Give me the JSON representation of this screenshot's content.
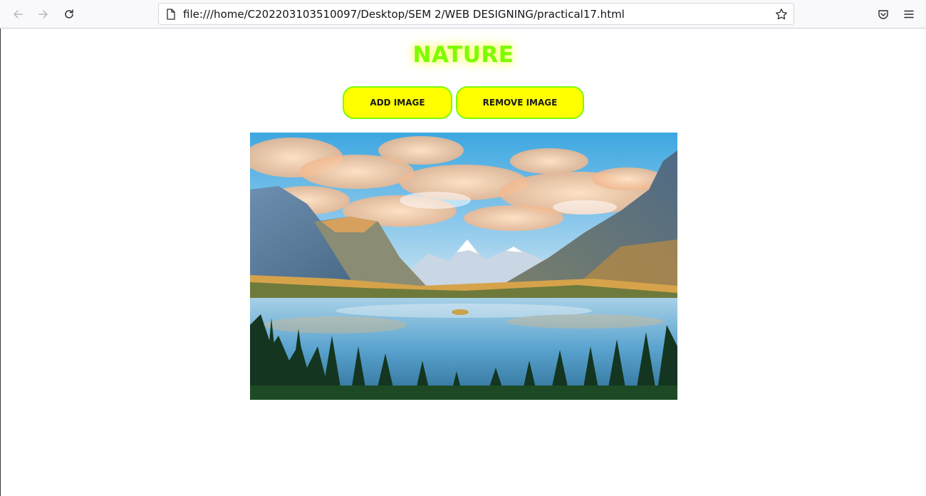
{
  "browser": {
    "url": "file:///home/C202203103510097/Desktop/SEM 2/WEB DESIGNING/practical17.html",
    "icons": [
      "back-arrow-icon",
      "forward-arrow-icon",
      "reload-icon",
      "page-icon",
      "bookmark-star-icon",
      "pocket-icon",
      "menu-icon"
    ]
  },
  "page": {
    "title": "NATURE",
    "add_button": "ADD IMAGE",
    "remove_button": "REMOVE IMAGE",
    "image_subject": "mountain-lake-landscape"
  },
  "colors": {
    "title": "#7cfc00",
    "button_bg": "#ffff00",
    "button_border": "#7cfc00"
  }
}
